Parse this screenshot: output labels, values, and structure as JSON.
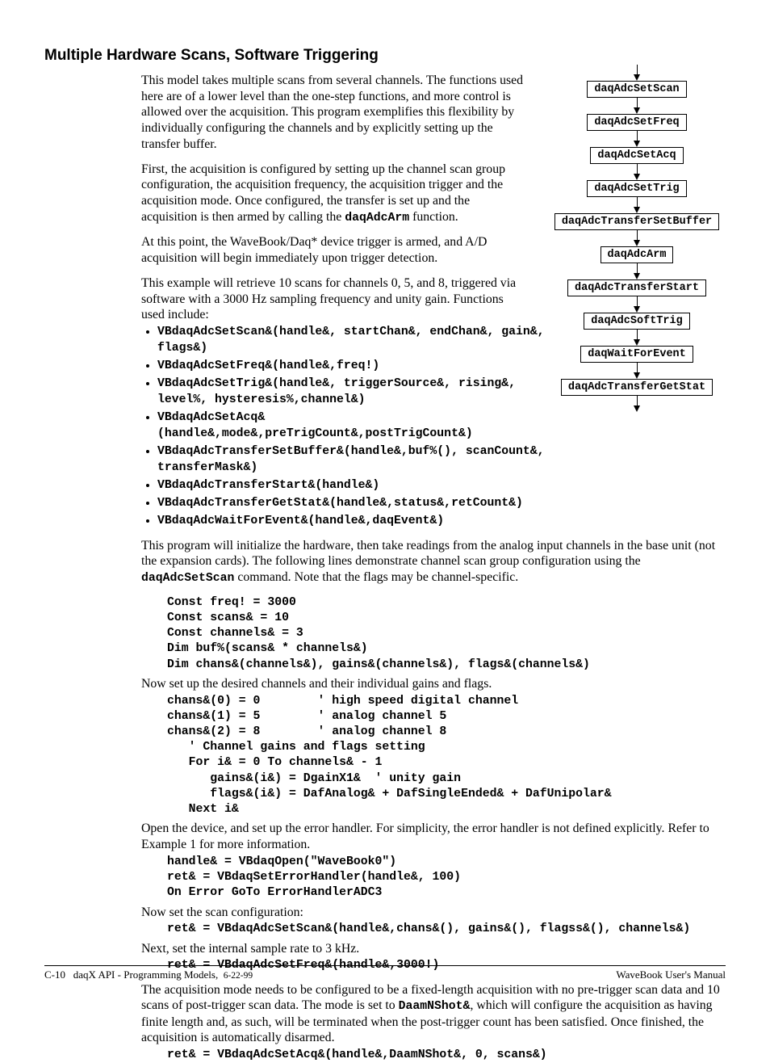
{
  "heading": "Multiple Hardware Scans, Software Triggering",
  "p1": "This model takes multiple scans from several channels.  The functions used here are of a lower level than the one-step functions, and more control is allowed over the acquisition.  This program exemplifies this flexibility by individually configuring the channels and by explicitly setting up the transfer buffer.",
  "p2a": "First, the acquisition is configured by setting up the channel scan group configuration, the acquisition frequency, the acquisition trigger and the acquisition mode.  Once configured, the transfer is set up and the acquisition is then armed by calling the ",
  "p2b": "daqAdcArm",
  "p2c": " function.",
  "p3": "At this point, the WaveBook/Daq* device trigger is armed, and A/D acquisition will begin immediately upon trigger detection.",
  "p4": "This example will retrieve 10 scans for channels 0, 5, and 8, triggered via software with a 3000 Hz sampling frequency and unity gain.  Functions used include:",
  "funcs": [
    "VBdaqAdcSetScan&(handle&, startChan&, endChan&, gain&, flags&)",
    "VBdaqAdcSetFreq&(handle&,freq!)",
    "VBdaqAdcSetTrig&(handle&, triggerSource&, rising&, level%, hysteresis%,channel&)",
    "VBdaqAdcSetAcq&(handle&,mode&,preTrigCount&,postTrigCount&)",
    "VBdaqAdcTransferSetBuffer&(handle&,buf%(), scanCount&, transferMask&)",
    "VBdaqAdcTransferStart&(handle&)",
    "VBdaqAdcTransferGetStat&(handle&,status&,retCount&)",
    "VBdaqAdcWaitForEvent&(handle&,daqEvent&)"
  ],
  "p5a": "This program will initialize the hardware, then take readings from the analog input channels in the base unit (not the expansion cards).  The following lines demonstrate channel scan group configuration using the ",
  "p5b": "daqAdcSetScan",
  "p5c": " command.  Note that the flags may be channel-specific.",
  "code1": "Const freq! = 3000\nConst scans& = 10\nConst channels& = 3\nDim buf%(scans& * channels&)\nDim chans&(channels&), gains&(channels&), flags&(channels&)",
  "p6": "Now set up the desired channels and their individual gains and flags.",
  "code2": "chans&(0) = 0        ' high speed digital channel\nchans&(1) = 5        ' analog channel 5\nchans&(2) = 8        ' analog channel 8\n   ' Channel gains and flags setting\n   For i& = 0 To channels& - 1\n      gains&(i&) = DgainX1&  ' unity gain\n      flags&(i&) = DafAnalog& + DafSingleEnded& + DafUnipolar&\n   Next i&",
  "p7": "Open the device, and set up the error handler.  For simplicity, the error handler is not defined explicitly.  Refer to Example 1 for more information.",
  "code3": "handle& = VBdaqOpen(\"WaveBook0\")\nret& = VBdaqSetErrorHandler(handle&, 100)\nOn Error GoTo ErrorHandlerADC3",
  "p8": "Now set the scan configuration:",
  "code4": "ret& = VBdaqAdcSetScan&(handle&,chans&(), gains&(), flagss&(), channels&)",
  "p9": "Next, set the internal sample rate to 3 kHz.",
  "code5": "ret& = VBdaqAdcSetFreq&(handle&,3000!)",
  "p10a": "The acquisition mode needs to be configured to be a fixed-length acquisition with no pre-trigger scan data and 10 scans of post-trigger scan data.  The mode is set to ",
  "p10b": "DaamNShot&",
  "p10c": ", which will configure the acquisition as having finite length and, as such, will be terminated when the post-trigger count has been satisfied.  Once finished, the acquisition is automatically disarmed.",
  "code6": "ret& = VBdaqAdcSetAcq&(handle&,DaamNShot&, 0, scans&)",
  "flow": [
    "daqAdcSetScan",
    "daqAdcSetFreq",
    "daqAdcSetAcq",
    "daqAdcSetTrig",
    "daqAdcTransferSetBuffer",
    "daqAdcArm",
    "daqAdcTransferStart",
    "daqAdcSoftTrig",
    "daqWaitForEvent",
    "daqAdcTransferGetStat"
  ],
  "footer": {
    "left_a": "C-10",
    "left_b": "daqX API - Programming Models,",
    "date": "6-22-99",
    "right": "WaveBook User's Manual"
  }
}
